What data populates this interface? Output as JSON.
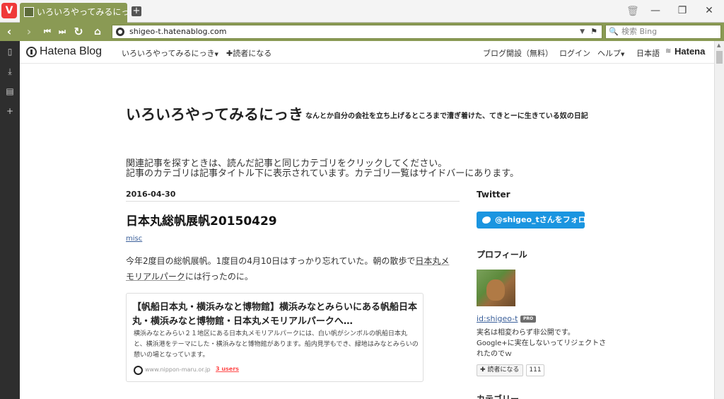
{
  "browser": {
    "tab_title": "いろいろやってみるにっき",
    "url": "shigeo-t.hatenablog.com",
    "search_placeholder": "検索 Bing",
    "accent_color": "#8a9a54"
  },
  "hatena_header": {
    "logo_text": "Hatena Blog",
    "blog_menu": "いろいろやってみるにっき",
    "subscribe": "読者になる",
    "open_blog": "ブログ開設（無料）",
    "login": "ログイン",
    "help": "ヘルプ",
    "language": "日本語",
    "hatena": "Hatena"
  },
  "blog": {
    "title": "いろいろやってみるにっき",
    "description": "なんとか自分の会社を立ち上げるところまで漕ぎ着けた、てきとーに生きている奴の日記",
    "notice_line1": "関連記事を探すときは、読んだ記事と同じカテゴリをクリックしてください。",
    "notice_line2": "記事のカテゴリは記事タイトル下に表示されています。カテゴリ一覧はサイドバーにあります。"
  },
  "entry": {
    "date": "2016-04-30",
    "title": "日本丸総帆展帆20150429",
    "category": "misc",
    "body_part1": "今年2度目の総帆展帆。1度目の4月10日はすっかり忘れていた。朝の散歩で",
    "body_link": "日本丸メモリアルパーク",
    "body_part2": "には行ったのに。"
  },
  "embed_card": {
    "title": "【帆船日本丸・横浜みなと博物館】横浜みなとみらいにある帆船日本丸・横浜みなと博物館・日本丸メモリアルパークへ…",
    "description": "横浜みなとみらい２１地区にある日本丸メモリアルパークには、白い帆がシンボルの帆船日本丸と、横浜港をテーマにした・横浜みなと博物館があります。船内見学もでき、緑地はみなとみらいの憩いの場となっています。",
    "domain": "www.nippon-maru.or.jp",
    "users": "3 users"
  },
  "sidebar": {
    "twitter_heading": "Twitter",
    "follow_button": "@shigeo_tさんをフォロー",
    "profile_heading": "プロフィール",
    "profile_id": "id:shigeo-t",
    "pro_badge": "PRO",
    "profile_text": "実名は相変わらず非公開です。Google+に実在しないってリジェクトされたのでｗ",
    "subscribe_label": "読者になる",
    "subscribe_count": "111",
    "category_heading": "カテゴリー"
  }
}
